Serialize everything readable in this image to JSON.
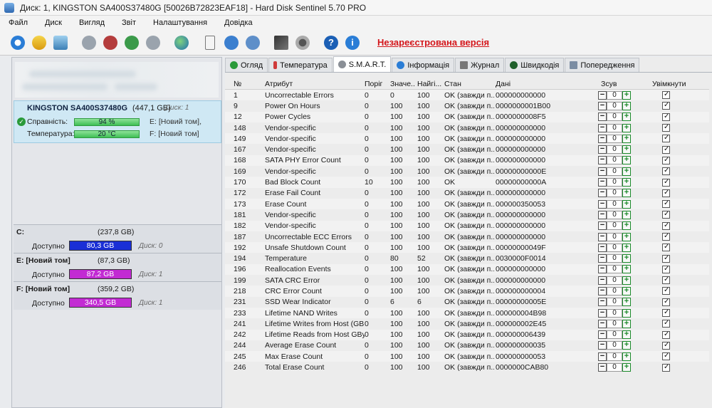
{
  "window": {
    "title": "Диск: 1, KINGSTON SA400S37480G [50026B72823EAF18]  -  Hard Disk Sentinel 5.70 PRO"
  },
  "menu": [
    "Файл",
    "Диск",
    "Вигляд",
    "Звіт",
    "Налаштування",
    "Довідка"
  ],
  "toolbar": {
    "icons": [
      "refresh-icon",
      "alert-icon",
      "disk-image-icon",
      "wrench-icon",
      "wrench-icon-2",
      "wrench-icon-3",
      "wrench-icon-4",
      "globe-icon",
      "report-icon",
      "send-report-icon",
      "cloud-icon",
      "chart-icon",
      "settings-icon",
      "help-icon",
      "info-icon"
    ],
    "unregistered": "Незареєстрована версія"
  },
  "left": {
    "disk": {
      "name": "KINGSTON SA400S37480G",
      "size": "(447,1 GB)",
      "disk_num": "Диск: 1",
      "health_label": "Справність:",
      "health_value": "94 %",
      "health_percent": 94,
      "health_volume": "E: [Новий том],",
      "temp_label": "Температура:",
      "temp_value": "20 °C",
      "temp_volume": "F: [Новий том]"
    },
    "volumes": [
      {
        "name": "C:",
        "total": "(237,8 GB)",
        "free_label": "Доступно",
        "free": "80,3 GB",
        "disk": "Диск: 0",
        "color": "#1a2fd6"
      },
      {
        "name": "E: [Новий том]",
        "total": "(87,3 GB)",
        "free_label": "Доступно",
        "free": "87,2 GB",
        "disk": "Диск: 1",
        "color": "#c22bd3"
      },
      {
        "name": "F: [Новий том]",
        "total": "(359,2 GB)",
        "free_label": "Доступно",
        "free": "340,5 GB",
        "disk": "Диск: 1",
        "color": "#c22bd3"
      }
    ]
  },
  "tabs": [
    {
      "label": "Огляд",
      "icon": "check-icon",
      "active": false
    },
    {
      "label": "Температура",
      "icon": "thermometer-icon",
      "active": false
    },
    {
      "label": "S.M.A.R.T.",
      "icon": "wrench-icon",
      "active": true
    },
    {
      "label": "Інформація",
      "icon": "info-icon",
      "active": false
    },
    {
      "label": "Журнал",
      "icon": "journal-icon",
      "active": false
    },
    {
      "label": "Швидкодія",
      "icon": "speed-icon",
      "active": false
    },
    {
      "label": "Попередження",
      "icon": "warning-icon",
      "active": false
    }
  ],
  "smart": {
    "headers": {
      "num": "№",
      "attr": "Атрибут",
      "thr": "Поріг",
      "val": "Значе...",
      "worst": "Найгі...",
      "state": "Стан",
      "raw": "Дані",
      "offset": "Зсув",
      "enabled": "Увімкнути"
    },
    "rows": [
      {
        "num": "1",
        "attr": "Uncorrectable Errors",
        "thr": "0",
        "val": "0",
        "worst": "100",
        "state": "OK (завжди п...",
        "raw": "000000000000",
        "off": "0"
      },
      {
        "num": "9",
        "attr": "Power On Hours",
        "thr": "0",
        "val": "100",
        "worst": "100",
        "state": "OK (завжди п...",
        "raw": "0000000001B00",
        "off": "0"
      },
      {
        "num": "12",
        "attr": "Power Cycles",
        "thr": "0",
        "val": "100",
        "worst": "100",
        "state": "OK (завжди п...",
        "raw": "0000000008F5",
        "off": "0"
      },
      {
        "num": "148",
        "attr": "Vendor-specific",
        "thr": "0",
        "val": "100",
        "worst": "100",
        "state": "OK (завжди п...",
        "raw": "000000000000",
        "off": "0"
      },
      {
        "num": "149",
        "attr": "Vendor-specific",
        "thr": "0",
        "val": "100",
        "worst": "100",
        "state": "OK (завжди п...",
        "raw": "000000000000",
        "off": "0"
      },
      {
        "num": "167",
        "attr": "Vendor-specific",
        "thr": "0",
        "val": "100",
        "worst": "100",
        "state": "OK (завжди п...",
        "raw": "000000000000",
        "off": "0"
      },
      {
        "num": "168",
        "attr": "SATA PHY Error Count",
        "thr": "0",
        "val": "100",
        "worst": "100",
        "state": "OK (завжди п...",
        "raw": "000000000000",
        "off": "0"
      },
      {
        "num": "169",
        "attr": "Vendor-specific",
        "thr": "0",
        "val": "100",
        "worst": "100",
        "state": "OK (завжди п...",
        "raw": "00000000000E",
        "off": "0"
      },
      {
        "num": "170",
        "attr": "Bad Block Count",
        "thr": "10",
        "val": "100",
        "worst": "100",
        "state": "OK",
        "raw": "00000000000A",
        "off": "0"
      },
      {
        "num": "172",
        "attr": "Erase Fail Count",
        "thr": "0",
        "val": "100",
        "worst": "100",
        "state": "OK (завжди п...",
        "raw": "000000000000",
        "off": "0"
      },
      {
        "num": "173",
        "attr": "Erase Count",
        "thr": "0",
        "val": "100",
        "worst": "100",
        "state": "OK (завжди п...",
        "raw": "000000350053",
        "off": "0"
      },
      {
        "num": "181",
        "attr": "Vendor-specific",
        "thr": "0",
        "val": "100",
        "worst": "100",
        "state": "OK (завжди п...",
        "raw": "000000000000",
        "off": "0"
      },
      {
        "num": "182",
        "attr": "Vendor-specific",
        "thr": "0",
        "val": "100",
        "worst": "100",
        "state": "OK (завжди п...",
        "raw": "000000000000",
        "off": "0"
      },
      {
        "num": "187",
        "attr": "Uncorrectable ECC Errors",
        "thr": "0",
        "val": "100",
        "worst": "100",
        "state": "OK (завжди п...",
        "raw": "000000000000",
        "off": "0"
      },
      {
        "num": "192",
        "attr": "Unsafe Shutdown Count",
        "thr": "0",
        "val": "100",
        "worst": "100",
        "state": "OK (завжди п...",
        "raw": "00000000049F",
        "off": "0"
      },
      {
        "num": "194",
        "attr": "Temperature",
        "thr": "0",
        "val": "80",
        "worst": "52",
        "state": "OK (завжди п...",
        "raw": "0030000F0014",
        "off": "0"
      },
      {
        "num": "196",
        "attr": "Reallocation Events",
        "thr": "0",
        "val": "100",
        "worst": "100",
        "state": "OK (завжди п...",
        "raw": "000000000000",
        "off": "0"
      },
      {
        "num": "199",
        "attr": "SATA CRC Error",
        "thr": "0",
        "val": "100",
        "worst": "100",
        "state": "OK (завжди п...",
        "raw": "000000000000",
        "off": "0"
      },
      {
        "num": "218",
        "attr": "CRC Error Count",
        "thr": "0",
        "val": "100",
        "worst": "100",
        "state": "OK (завжди п...",
        "raw": "000000000004",
        "off": "0"
      },
      {
        "num": "231",
        "attr": "SSD Wear Indicator",
        "thr": "0",
        "val": "6",
        "worst": "6",
        "state": "OK (завжди п...",
        "raw": "00000000005E",
        "off": "0"
      },
      {
        "num": "233",
        "attr": "Lifetime NAND Writes",
        "thr": "0",
        "val": "100",
        "worst": "100",
        "state": "OK (завжди п...",
        "raw": "000000004B98",
        "off": "0"
      },
      {
        "num": "241",
        "attr": "Lifetime Writes from Host (GB...",
        "thr": "0",
        "val": "100",
        "worst": "100",
        "state": "OK (завжди п...",
        "raw": "000000002E45",
        "off": "0"
      },
      {
        "num": "242",
        "attr": "Lifetime Reads from Host GBy...",
        "thr": "0",
        "val": "100",
        "worst": "100",
        "state": "OK (завжди п...",
        "raw": "000000006439",
        "off": "0"
      },
      {
        "num": "244",
        "attr": "Average Erase Count",
        "thr": "0",
        "val": "100",
        "worst": "100",
        "state": "OK (завжди п...",
        "raw": "000000000035",
        "off": "0"
      },
      {
        "num": "245",
        "attr": "Max Erase Count",
        "thr": "0",
        "val": "100",
        "worst": "100",
        "state": "OK (завжди п...",
        "raw": "000000000053",
        "off": "0"
      },
      {
        "num": "246",
        "attr": "Total Erase Count",
        "thr": "0",
        "val": "100",
        "worst": "100",
        "state": "OK (завжди п...",
        "raw": "0000000CAB80",
        "off": "0"
      }
    ]
  }
}
